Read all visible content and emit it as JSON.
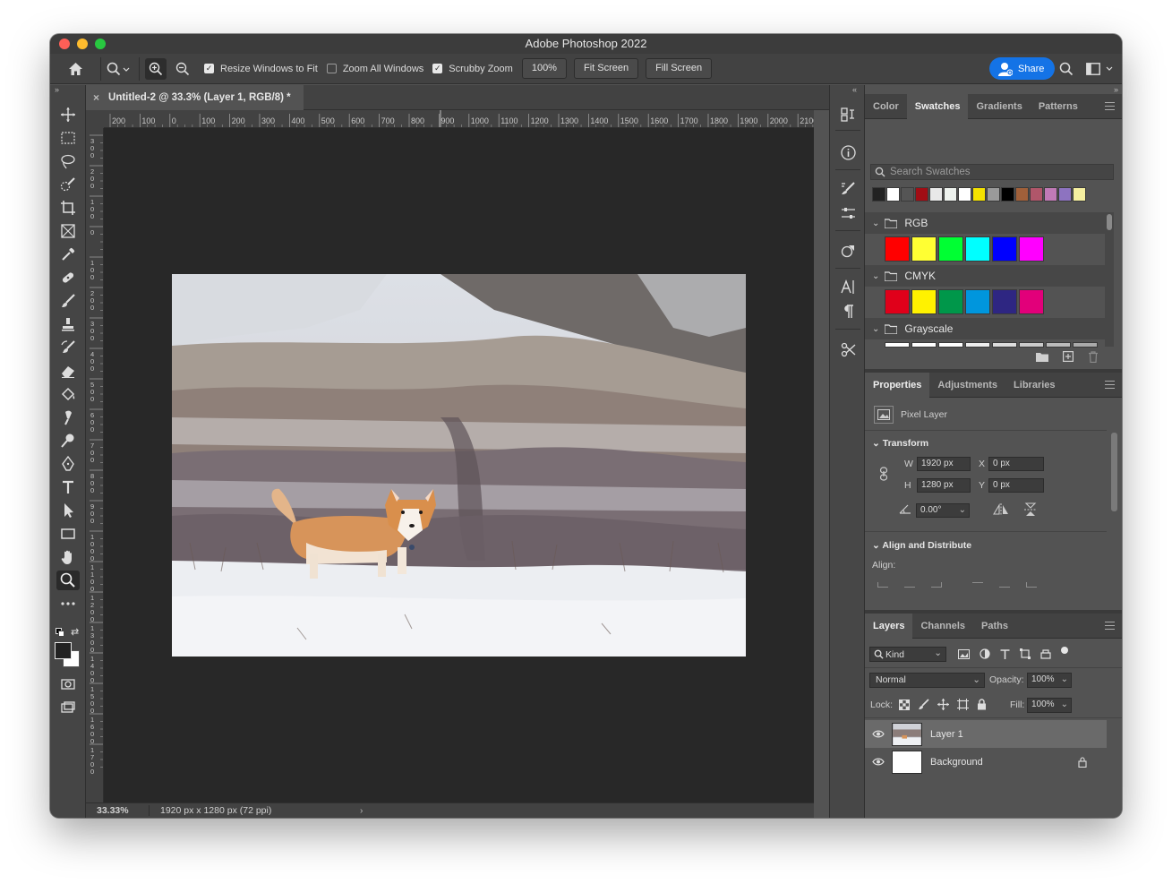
{
  "app": {
    "title": "Adobe Photoshop 2022"
  },
  "options_bar": {
    "resize_windows_label": "Resize Windows to Fit",
    "resize_windows_checked": true,
    "zoom_all_label": "Zoom All Windows",
    "zoom_all_checked": false,
    "scrubby_zoom_label": "Scrubby Zoom",
    "scrubby_zoom_checked": true,
    "zoom_value": "100%",
    "fit_screen_label": "Fit Screen",
    "fill_screen_label": "Fill Screen",
    "share_label": "Share",
    "accent_color": "#1473e6"
  },
  "document": {
    "tab_title": "Untitled-2 @ 33.3% (Layer 1, RGB/8) *",
    "zoom_status": "33.33%",
    "size_status": "1920 px x 1280 px (72 ppi)",
    "ruler_labels": [
      "200",
      "100",
      "0",
      "100",
      "200",
      "300",
      "400",
      "500",
      "600",
      "700",
      "800",
      "900",
      "1000",
      "1100",
      "1200",
      "1300",
      "1400",
      "1500",
      "1600",
      "1700",
      "1800",
      "1900",
      "2000",
      "2100"
    ],
    "vertical_ruler_labels": [
      "300",
      "200",
      "100",
      "0",
      "100",
      "200",
      "300",
      "400",
      "500",
      "600",
      "700",
      "800",
      "900",
      "1000",
      "1100",
      "1200",
      "1300",
      "1400",
      "1500",
      "1600",
      "1700"
    ]
  },
  "tools": [
    {
      "name": "move-tool-icon"
    },
    {
      "name": "marquee-tool-icon"
    },
    {
      "name": "lasso-tool-icon"
    },
    {
      "name": "quick-select-tool-icon"
    },
    {
      "name": "crop-tool-icon"
    },
    {
      "name": "frame-tool-icon"
    },
    {
      "name": "eyedropper-tool-icon"
    },
    {
      "name": "healing-brush-tool-icon"
    },
    {
      "name": "brush-tool-icon"
    },
    {
      "name": "clone-stamp-tool-icon"
    },
    {
      "name": "history-brush-tool-icon"
    },
    {
      "name": "eraser-tool-icon"
    },
    {
      "name": "paint-bucket-tool-icon"
    },
    {
      "name": "smudge-tool-icon"
    },
    {
      "name": "dodge-tool-icon"
    },
    {
      "name": "pen-tool-icon"
    },
    {
      "name": "type-tool-icon"
    },
    {
      "name": "path-select-tool-icon"
    },
    {
      "name": "rectangle-tool-icon"
    },
    {
      "name": "hand-tool-icon"
    },
    {
      "name": "zoom-tool-icon"
    },
    {
      "name": "more-tools-icon"
    }
  ],
  "swatches_panel": {
    "tabs": [
      "Color",
      "Swatches",
      "Gradients",
      "Patterns"
    ],
    "active_tab": "Swatches",
    "search_placeholder": "Search Swatches",
    "recent_colors": [
      "#222222",
      "#ffffff",
      "#555555",
      "#a10d15",
      "#e8e8e8",
      "#eef2ee",
      "#ffffff",
      "#f5e200",
      "#9a9a9a",
      "#000000",
      "#a0603a",
      "#b0566a",
      "#c07ab6",
      "#8d73c0",
      "#f6f0a0"
    ],
    "groups": [
      {
        "name": "RGB",
        "colors": [
          "#ff0000",
          "#ffff33",
          "#00ff33",
          "#00ffff",
          "#0000ff",
          "#ff00ff"
        ]
      },
      {
        "name": "CMYK",
        "colors": [
          "#e0001a",
          "#fff200",
          "#00974a",
          "#0096dd",
          "#2e2682",
          "#e2007a"
        ]
      },
      {
        "name": "Grayscale",
        "colors": [
          "#ffffff",
          "#ffffff",
          "#ffffff",
          "#eeeeee",
          "#dddddd",
          "#cccccc",
          "#bbbbbb",
          "#aaaaaa"
        ]
      }
    ]
  },
  "properties_panel": {
    "tabs": [
      "Properties",
      "Adjustments",
      "Libraries"
    ],
    "active_tab": "Properties",
    "layer_type": "Pixel Layer",
    "transform_title": "Transform",
    "w_label": "W",
    "w_value": "1920 px",
    "h_label": "H",
    "h_value": "1280 px",
    "x_label": "X",
    "x_value": "0 px",
    "y_label": "Y",
    "y_value": "0 px",
    "angle_value": "0.00°",
    "align_title": "Align and Distribute",
    "align_label": "Align:"
  },
  "layers_panel": {
    "tabs": [
      "Layers",
      "Channels",
      "Paths"
    ],
    "active_tab": "Layers",
    "filter_label": "Kind",
    "blend_mode": "Normal",
    "opacity_label": "Opacity:",
    "opacity_value": "100%",
    "lock_label": "Lock:",
    "fill_label": "Fill:",
    "fill_value": "100%",
    "layers": [
      {
        "name": "Layer 1",
        "selected": true,
        "locked": false
      },
      {
        "name": "Background",
        "selected": false,
        "locked": true
      }
    ]
  }
}
